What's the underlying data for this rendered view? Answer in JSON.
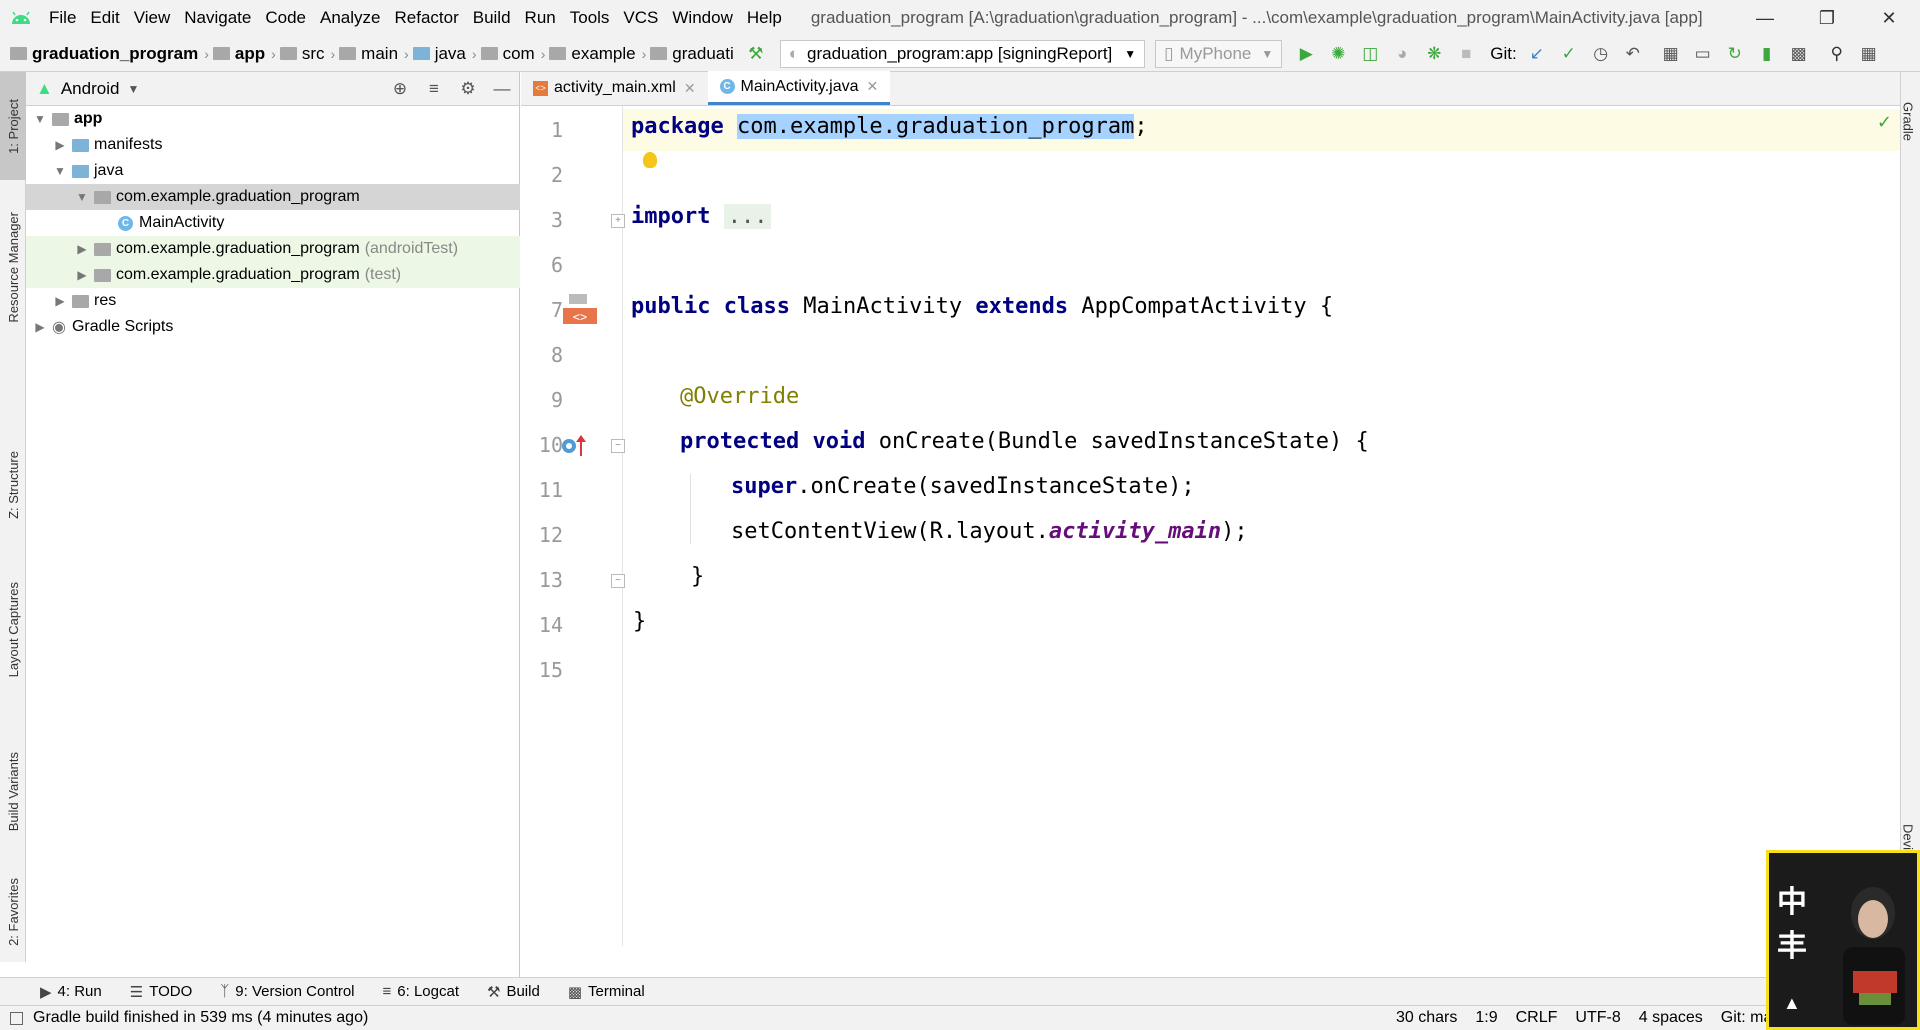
{
  "menu": [
    "File",
    "Edit",
    "View",
    "Navigate",
    "Code",
    "Analyze",
    "Refactor",
    "Build",
    "Run",
    "Tools",
    "VCS",
    "Window",
    "Help"
  ],
  "window_title": "graduation_program [A:\\graduation\\graduation_program] - ...\\com\\example\\graduation_program\\MainActivity.java [app]",
  "breadcrumb": [
    "graduation_program",
    "app",
    "src",
    "main",
    "java",
    "com",
    "example",
    "graduati"
  ],
  "run_config": "graduation_program:app [signingReport]",
  "device": "MyPhone",
  "git_label": "Git:",
  "left_tabs": [
    "1: Project",
    "Resource Manager",
    "Z: Structure",
    "Layout Captures",
    "Build Variants",
    "2: Favorites"
  ],
  "right_tabs": [
    "Gradle",
    "Devi"
  ],
  "project_panel": {
    "view": "Android",
    "tree": [
      {
        "label": "app",
        "hint": ""
      },
      {
        "label": "manifests",
        "hint": ""
      },
      {
        "label": "java",
        "hint": ""
      },
      {
        "label": "com.example.graduation_program",
        "hint": ""
      },
      {
        "label": "MainActivity",
        "hint": ""
      },
      {
        "label": "com.example.graduation_program",
        "hint": "(androidTest)"
      },
      {
        "label": "com.example.graduation_program",
        "hint": "(test)"
      },
      {
        "label": "res",
        "hint": ""
      },
      {
        "label": "Gradle Scripts",
        "hint": ""
      }
    ]
  },
  "editor_tabs": [
    "activity_main.xml",
    "MainActivity.java"
  ],
  "line_numbers": [
    "1",
    "2",
    "3",
    "6",
    "7",
    "8",
    "9",
    "10",
    "11",
    "12",
    "13",
    "14",
    "15"
  ],
  "code": {
    "l1_kw": "package",
    "l1_pkg": "com.example.graduation_program",
    "l1_end": ";",
    "l3_kw": "import",
    "l3_fold": "...",
    "l7_kw1": "public",
    "l7_kw2": "class",
    "l7_name": "MainActivity",
    "l7_kw3": "extends",
    "l7_super": "AppCompatActivity",
    "l7_brace": "{",
    "l9_ann": "@Override",
    "l10_kw1": "protected",
    "l10_kw2": "void",
    "l10_rest": "onCreate(Bundle savedInstanceState) {",
    "l11_kw": "super",
    "l11_rest": ".onCreate(savedInstanceState);",
    "l12_pre": "setContentView(R.layout.",
    "l12_field": "activity_main",
    "l12_post": ");",
    "l13": "}",
    "l14": "}"
  },
  "bottom_tools": [
    "4: Run",
    "TODO",
    "9: Version Control",
    "6: Logcat",
    "Build",
    "Terminal"
  ],
  "status": {
    "message": "Gradle build finished in 539 ms (4 minutes ago)",
    "chars": "30 chars",
    "position": "1:9",
    "line_sep": "CRLF",
    "encoding": "UTF-8",
    "indent": "4 spaces",
    "git": "Git: maste"
  },
  "overlay": {
    "text": "中丰"
  },
  "colors": {
    "accent": "#4083c9",
    "keyword": "#000080",
    "annotation": "#808000",
    "selection": "#a6d2ff",
    "run_green": "#3da83d"
  }
}
